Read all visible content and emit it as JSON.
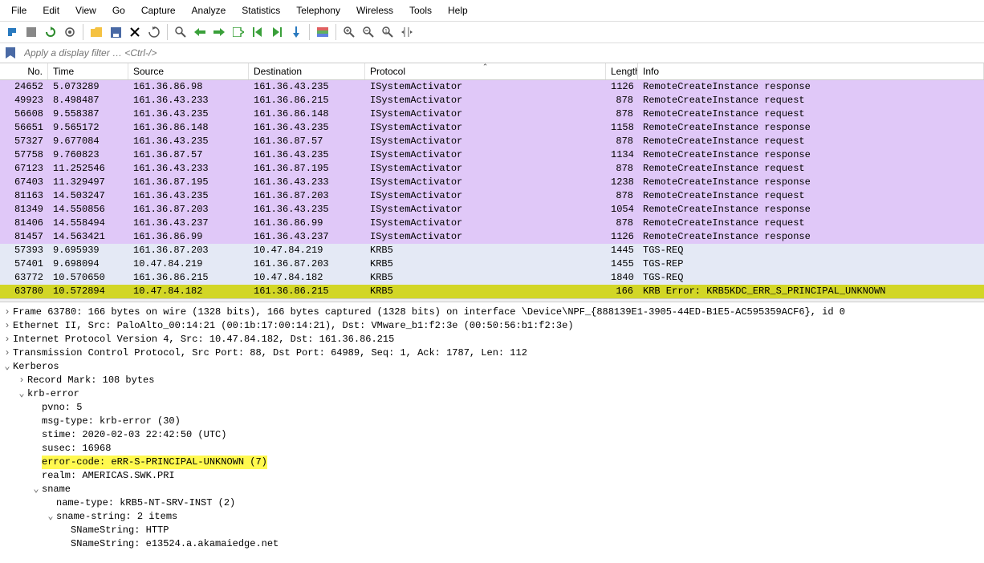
{
  "menu": [
    "File",
    "Edit",
    "View",
    "Go",
    "Capture",
    "Analyze",
    "Statistics",
    "Telephony",
    "Wireless",
    "Tools",
    "Help"
  ],
  "filter_placeholder": "Apply a display filter … <Ctrl-/>",
  "columns": {
    "no": "No.",
    "time": "Time",
    "source": "Source",
    "destination": "Destination",
    "protocol": "Protocol",
    "length": "Length",
    "info": "Info"
  },
  "packets": [
    {
      "no": "24652",
      "time": "5.073289",
      "src": "161.36.86.98",
      "dst": "161.36.43.235",
      "proto": "ISystemActivator",
      "len": "1126",
      "info": "RemoteCreateInstance response",
      "bg": "purple"
    },
    {
      "no": "49923",
      "time": "8.498487",
      "src": "161.36.43.233",
      "dst": "161.36.86.215",
      "proto": "ISystemActivator",
      "len": "878",
      "info": "RemoteCreateInstance request",
      "bg": "purple"
    },
    {
      "no": "56608",
      "time": "9.558387",
      "src": "161.36.43.235",
      "dst": "161.36.86.148",
      "proto": "ISystemActivator",
      "len": "878",
      "info": "RemoteCreateInstance request",
      "bg": "purple"
    },
    {
      "no": "56651",
      "time": "9.565172",
      "src": "161.36.86.148",
      "dst": "161.36.43.235",
      "proto": "ISystemActivator",
      "len": "1158",
      "info": "RemoteCreateInstance response",
      "bg": "purple"
    },
    {
      "no": "57327",
      "time": "9.677084",
      "src": "161.36.43.235",
      "dst": "161.36.87.57",
      "proto": "ISystemActivator",
      "len": "878",
      "info": "RemoteCreateInstance request",
      "bg": "purple"
    },
    {
      "no": "57758",
      "time": "9.760823",
      "src": "161.36.87.57",
      "dst": "161.36.43.235",
      "proto": "ISystemActivator",
      "len": "1134",
      "info": "RemoteCreateInstance response",
      "bg": "purple"
    },
    {
      "no": "67123",
      "time": "11.252546",
      "src": "161.36.43.233",
      "dst": "161.36.87.195",
      "proto": "ISystemActivator",
      "len": "878",
      "info": "RemoteCreateInstance request",
      "bg": "purple"
    },
    {
      "no": "67403",
      "time": "11.329497",
      "src": "161.36.87.195",
      "dst": "161.36.43.233",
      "proto": "ISystemActivator",
      "len": "1238",
      "info": "RemoteCreateInstance response",
      "bg": "purple"
    },
    {
      "no": "81163",
      "time": "14.503247",
      "src": "161.36.43.235",
      "dst": "161.36.87.203",
      "proto": "ISystemActivator",
      "len": "878",
      "info": "RemoteCreateInstance request",
      "bg": "purple"
    },
    {
      "no": "81349",
      "time": "14.550856",
      "src": "161.36.87.203",
      "dst": "161.36.43.235",
      "proto": "ISystemActivator",
      "len": "1054",
      "info": "RemoteCreateInstance response",
      "bg": "purple"
    },
    {
      "no": "81406",
      "time": "14.558494",
      "src": "161.36.43.237",
      "dst": "161.36.86.99",
      "proto": "ISystemActivator",
      "len": "878",
      "info": "RemoteCreateInstance request",
      "bg": "purple"
    },
    {
      "no": "81457",
      "time": "14.563421",
      "src": "161.36.86.99",
      "dst": "161.36.43.237",
      "proto": "ISystemActivator",
      "len": "1126",
      "info": "RemoteCreateInstance response",
      "bg": "purple"
    },
    {
      "no": "57393",
      "time": "9.695939",
      "src": "161.36.87.203",
      "dst": "10.47.84.219",
      "proto": "KRB5",
      "len": "1445",
      "info": "TGS-REQ",
      "bg": "lblue"
    },
    {
      "no": "57401",
      "time": "9.698094",
      "src": "10.47.84.219",
      "dst": "161.36.87.203",
      "proto": "KRB5",
      "len": "1455",
      "info": "TGS-REP",
      "bg": "lblue"
    },
    {
      "no": "63772",
      "time": "10.570650",
      "src": "161.36.86.215",
      "dst": "10.47.84.182",
      "proto": "KRB5",
      "len": "1840",
      "info": "TGS-REQ",
      "bg": "lblue"
    },
    {
      "no": "63780",
      "time": "10.572894",
      "src": "10.47.84.182",
      "dst": "161.36.86.215",
      "proto": "KRB5",
      "len": "166",
      "info": "KRB Error: KRB5KDC_ERR_S_PRINCIPAL_UNKNOWN",
      "bg": "yellow"
    }
  ],
  "details": [
    {
      "indent": 0,
      "toggle": ">",
      "text": "Frame 63780: 166 bytes on wire (1328 bits), 166 bytes captured (1328 bits) on interface \\Device\\NPF_{888139E1-3905-44ED-B1E5-AC595359ACF6}, id 0"
    },
    {
      "indent": 0,
      "toggle": ">",
      "text": "Ethernet II, Src: PaloAlto_00:14:21 (00:1b:17:00:14:21), Dst: VMware_b1:f2:3e (00:50:56:b1:f2:3e)"
    },
    {
      "indent": 0,
      "toggle": ">",
      "text": "Internet Protocol Version 4, Src: 10.47.84.182, Dst: 161.36.86.215"
    },
    {
      "indent": 0,
      "toggle": ">",
      "text": "Transmission Control Protocol, Src Port: 88, Dst Port: 64989, Seq: 1, Ack: 1787, Len: 112"
    },
    {
      "indent": 0,
      "toggle": "v",
      "text": "Kerberos"
    },
    {
      "indent": 1,
      "toggle": ">",
      "text": "Record Mark: 108 bytes"
    },
    {
      "indent": 1,
      "toggle": "v",
      "text": "krb-error"
    },
    {
      "indent": 2,
      "toggle": "",
      "text": "pvno: 5"
    },
    {
      "indent": 2,
      "toggle": "",
      "text": "msg-type: krb-error (30)"
    },
    {
      "indent": 2,
      "toggle": "",
      "text": "stime: 2020-02-03 22:42:50 (UTC)"
    },
    {
      "indent": 2,
      "toggle": "",
      "text": "susec: 16968"
    },
    {
      "indent": 2,
      "toggle": "",
      "text": "error-code: eRR-S-PRINCIPAL-UNKNOWN (7)",
      "hl": true
    },
    {
      "indent": 2,
      "toggle": "",
      "text": "realm: AMERICAS.SWK.PRI"
    },
    {
      "indent": 2,
      "toggle": "v",
      "text": "sname"
    },
    {
      "indent": 3,
      "toggle": "",
      "text": "name-type: kRB5-NT-SRV-INST (2)"
    },
    {
      "indent": 3,
      "toggle": "v",
      "text": "sname-string: 2 items"
    },
    {
      "indent": 4,
      "toggle": "",
      "text": "SNameString: HTTP"
    },
    {
      "indent": 4,
      "toggle": "",
      "text": "SNameString: e13524.a.akamaiedge.net"
    }
  ]
}
